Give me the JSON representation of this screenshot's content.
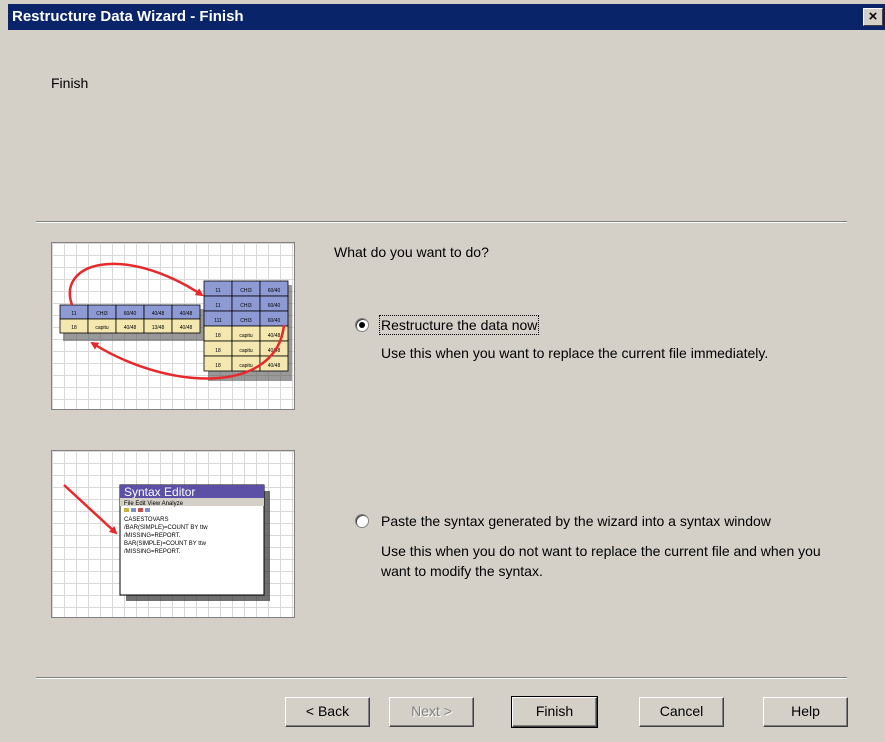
{
  "window": {
    "title": "Restructure Data Wizard - Finish",
    "close_label": "×"
  },
  "header": {
    "title": "Finish"
  },
  "question": "What do you want to do?",
  "options": [
    {
      "label": "Restructure the data now",
      "description": "Use this when you want to replace the current file immediately.",
      "selected": true
    },
    {
      "label": "Paste the syntax generated by the wizard into a syntax window",
      "description": "Use this when you do not want to replace the current file and when you want to modify the syntax.",
      "selected": false
    }
  ],
  "illustration_restructure": {
    "wide_rows": [
      [
        "11",
        "CHI3",
        "60/40",
        "40/48",
        "40/48"
      ],
      [
        "18",
        "capitu",
        "40/48",
        "13/48",
        "40/48"
      ]
    ],
    "long_rows": [
      [
        "11",
        "CHI3",
        "60/40"
      ],
      [
        "11",
        "CHI3",
        "60/40"
      ],
      [
        "111",
        "CHI3",
        "60/40"
      ],
      [
        "18",
        "capitu",
        "40/48"
      ],
      [
        "18",
        "capitu",
        "40/48"
      ],
      [
        "18",
        "capitu",
        "40/48"
      ]
    ],
    "arrow_color": "#e8282a"
  },
  "illustration_syntax": {
    "window_title": "Syntax Editor",
    "menu": "File  Edit  View  Analyze",
    "lines": [
      "CASESTOVARS",
      "  /BAR(SIMPLE)=COUNT BY ttw",
      "  /MISSING=REPORT.",
      "BAR(SIMPLE)=COUNT BY ttw",
      "  /MISSING=REPORT."
    ],
    "title_color": "#5b4fa6"
  },
  "buttons": {
    "back": "< Back",
    "next": "Next >",
    "finish": "Finish",
    "cancel": "Cancel",
    "help": "Help"
  }
}
